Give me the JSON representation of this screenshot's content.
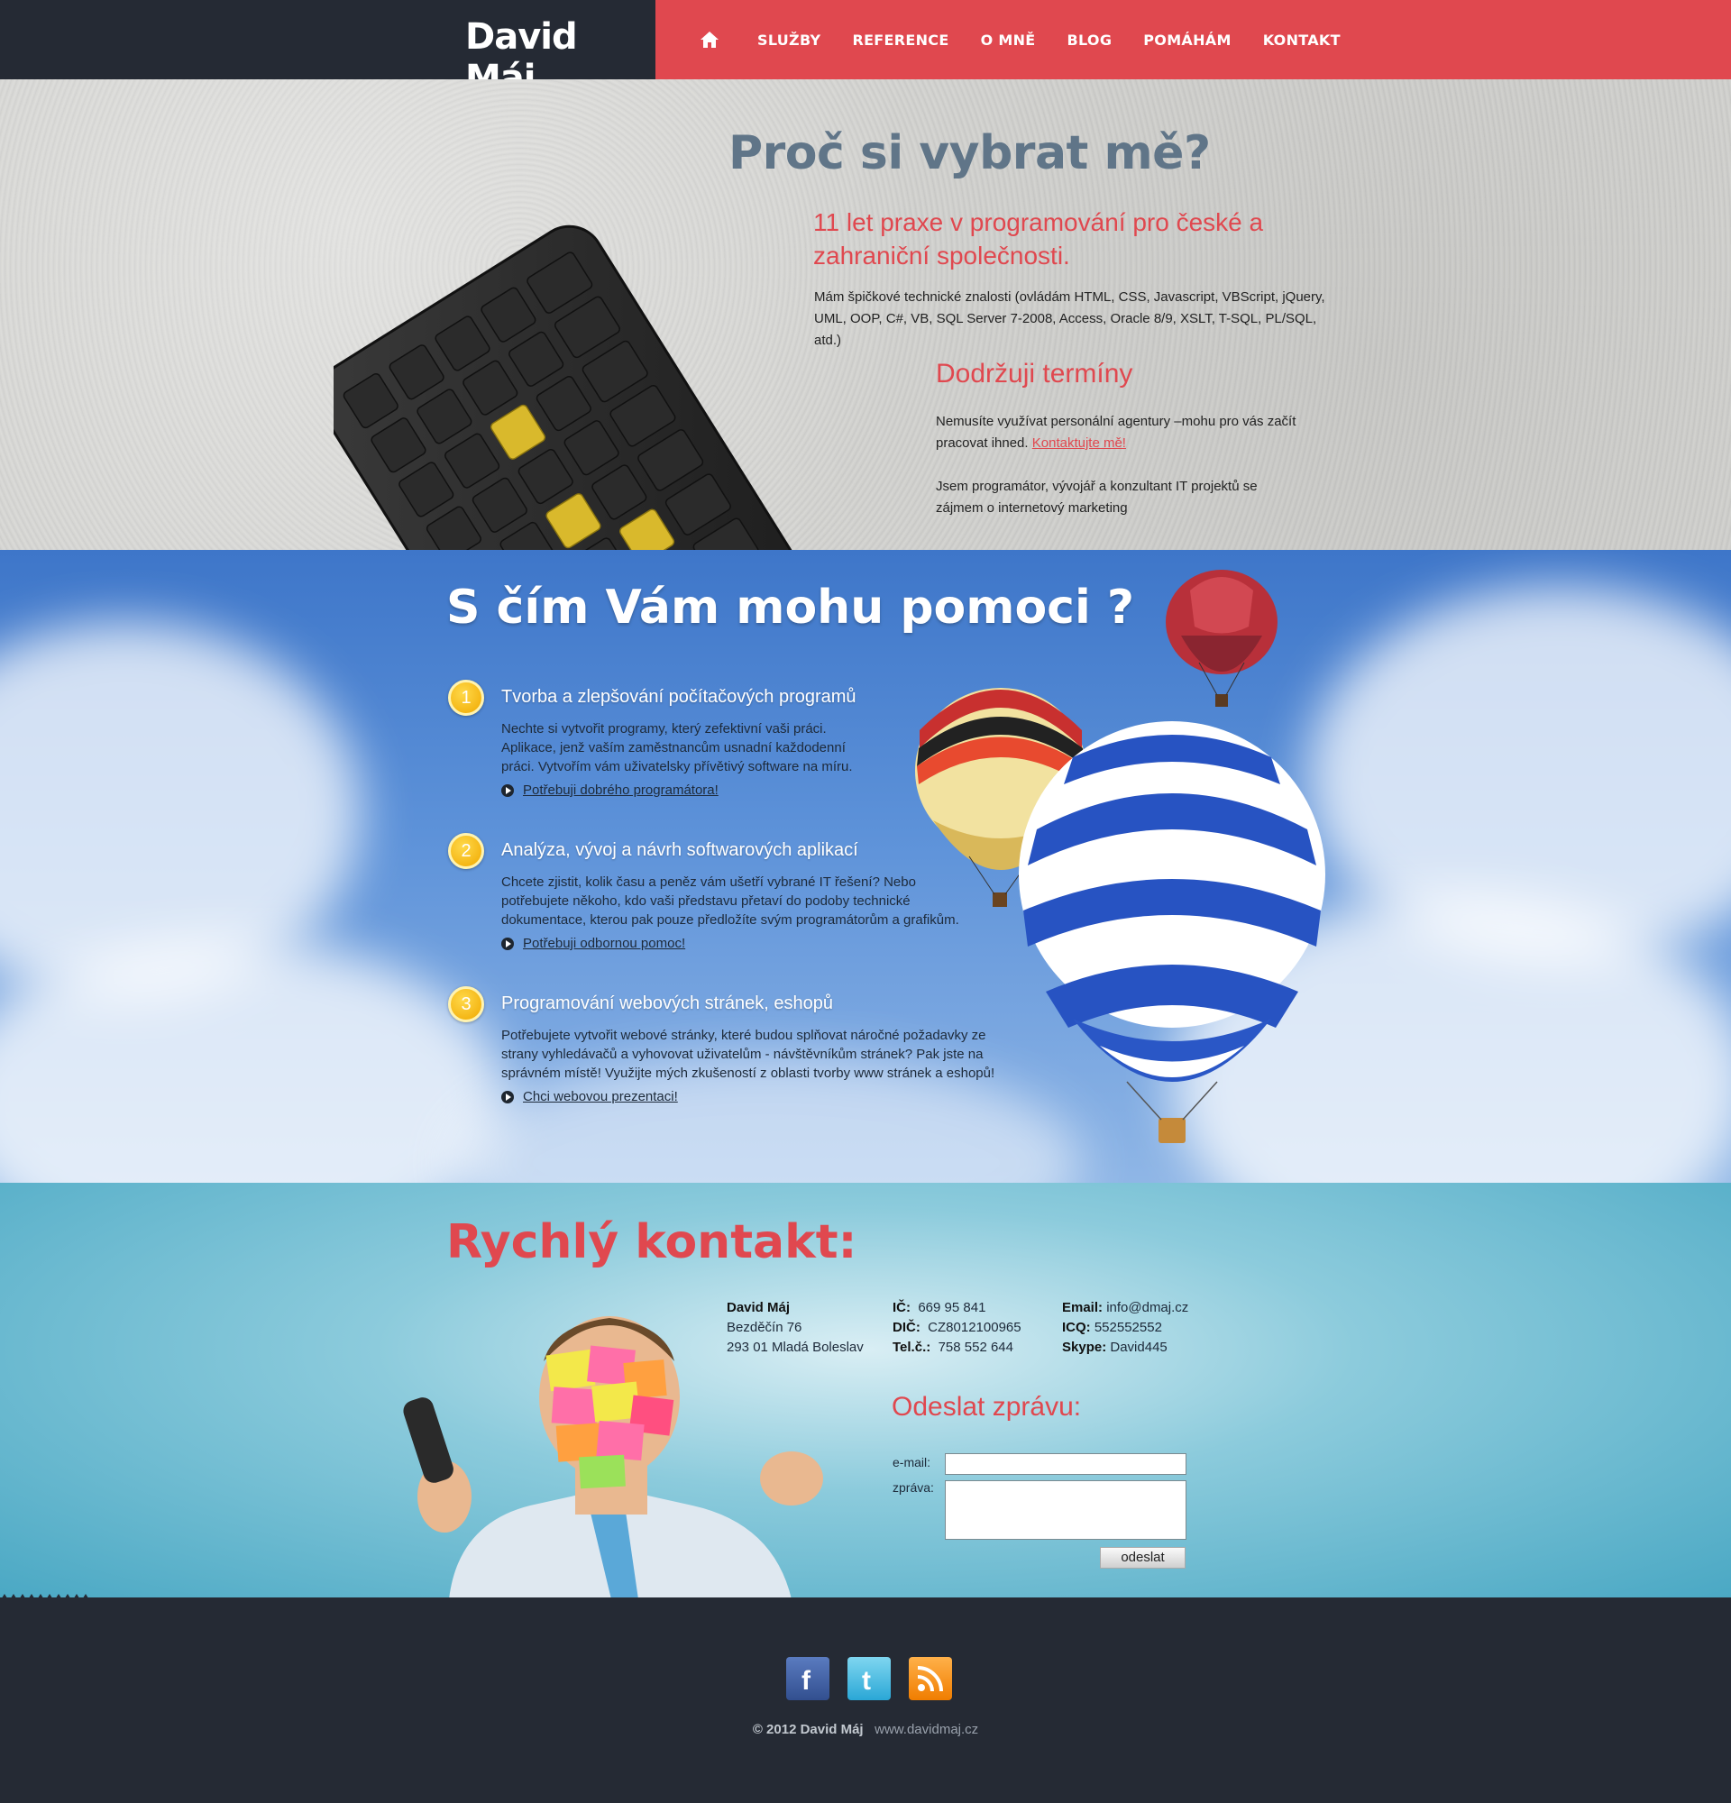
{
  "header": {
    "logo": "David Máj",
    "nav": [
      "SLUŽBY",
      "REFERENCE",
      "O MNĚ",
      "BLOG",
      "POMÁHÁM",
      "KONTAKT"
    ],
    "home_icon": "home-icon"
  },
  "hero": {
    "title": "Proč si vybrat mě?",
    "subtitle": "11 let praxe v programování pro české a zahraniční společnosti.",
    "text1": "Mám špičkové technické znalosti (ovládám HTML, CSS, Javascript, VBScript, jQuery, UML, OOP, C#, VB, SQL Server 7-2008, Access, Oracle 8/9, XSLT, T-SQL, PL/SQL, atd.)",
    "h2": "Dodržuji termíny",
    "text2": "Nemusíte využívat personální agentury –mohu pro vás začít pracovat ihned.",
    "text2_link": "Kontaktujte mě!",
    "text3": "Jsem programátor, vývojář a konzultant IT projektů se zájmem o internetový marketing"
  },
  "services": {
    "title": "S čím Vám mohu pomoci ?",
    "items": [
      {
        "num": "1",
        "title": "Tvorba a zlepšování počítačových programů",
        "text": "Nechte si vytvořit programy, který zefektivní vaši práci. Aplikace, jenž vaším zaměstnancům usnadní každodenní práci. Vytvořím vám uživatelsky přívětivý software na míru.",
        "link": "Potřebuji dobrého programátora!"
      },
      {
        "num": "2",
        "title": "Analýza, vývoj a návrh softwarových aplikací",
        "text": "Chcete zjistit, kolik času a peněz vám ušetří vybrané IT řešení? Nebo potřebujete někoho, kdo vaši představu přetaví do podoby technické dokumentace, kterou pak pouze předložíte svým programátorům a grafikům.",
        "link": "Potřebuji odbornou pomoc!"
      },
      {
        "num": "3",
        "title": "Programování webových stránek, eshopů",
        "text": "Potřebujete vytvořit webové stránky, které budou splňovat náročné požadavky ze strany vyhledávačů a vyhovovat uživatelům - návštěvníkům stránek? Pak jste na správném místě! Využijte mých zkušeností z oblasti tvorby www stránek a eshopů!",
        "link": "Chci webovou prezentaci!"
      }
    ]
  },
  "contact": {
    "title": "Rychlý kontakt:",
    "name": "David Máj",
    "street": "Bezděčín 76",
    "city": "293 01 Mladá Boleslav",
    "ic_label": "IČ:",
    "ic": "669 95 841",
    "dic_label": "DIČ:",
    "dic": "CZ8012100965",
    "tel_label": "Tel.č.:",
    "tel": "758 552 644",
    "email_label": "Email:",
    "email": "info@dmaj.cz",
    "icq_label": "ICQ:",
    "icq": "552552552",
    "skype_label": "Skype:",
    "skype": "David445",
    "form_title": "Odeslat zprávu:",
    "email_field_label": "e-mail:",
    "message_field_label": "zpráva:",
    "email_value": "",
    "message_value": "",
    "submit": "odeslat"
  },
  "footer": {
    "copyright": "© 2012 David Máj",
    "site": "www.davidmaj.cz",
    "social": [
      "facebook-icon",
      "twitter-icon",
      "rss-icon"
    ]
  },
  "colors": {
    "accent_red": "#e0484f",
    "dark": "#252a34",
    "hero_title": "#607588",
    "badge": "#f5b800"
  }
}
